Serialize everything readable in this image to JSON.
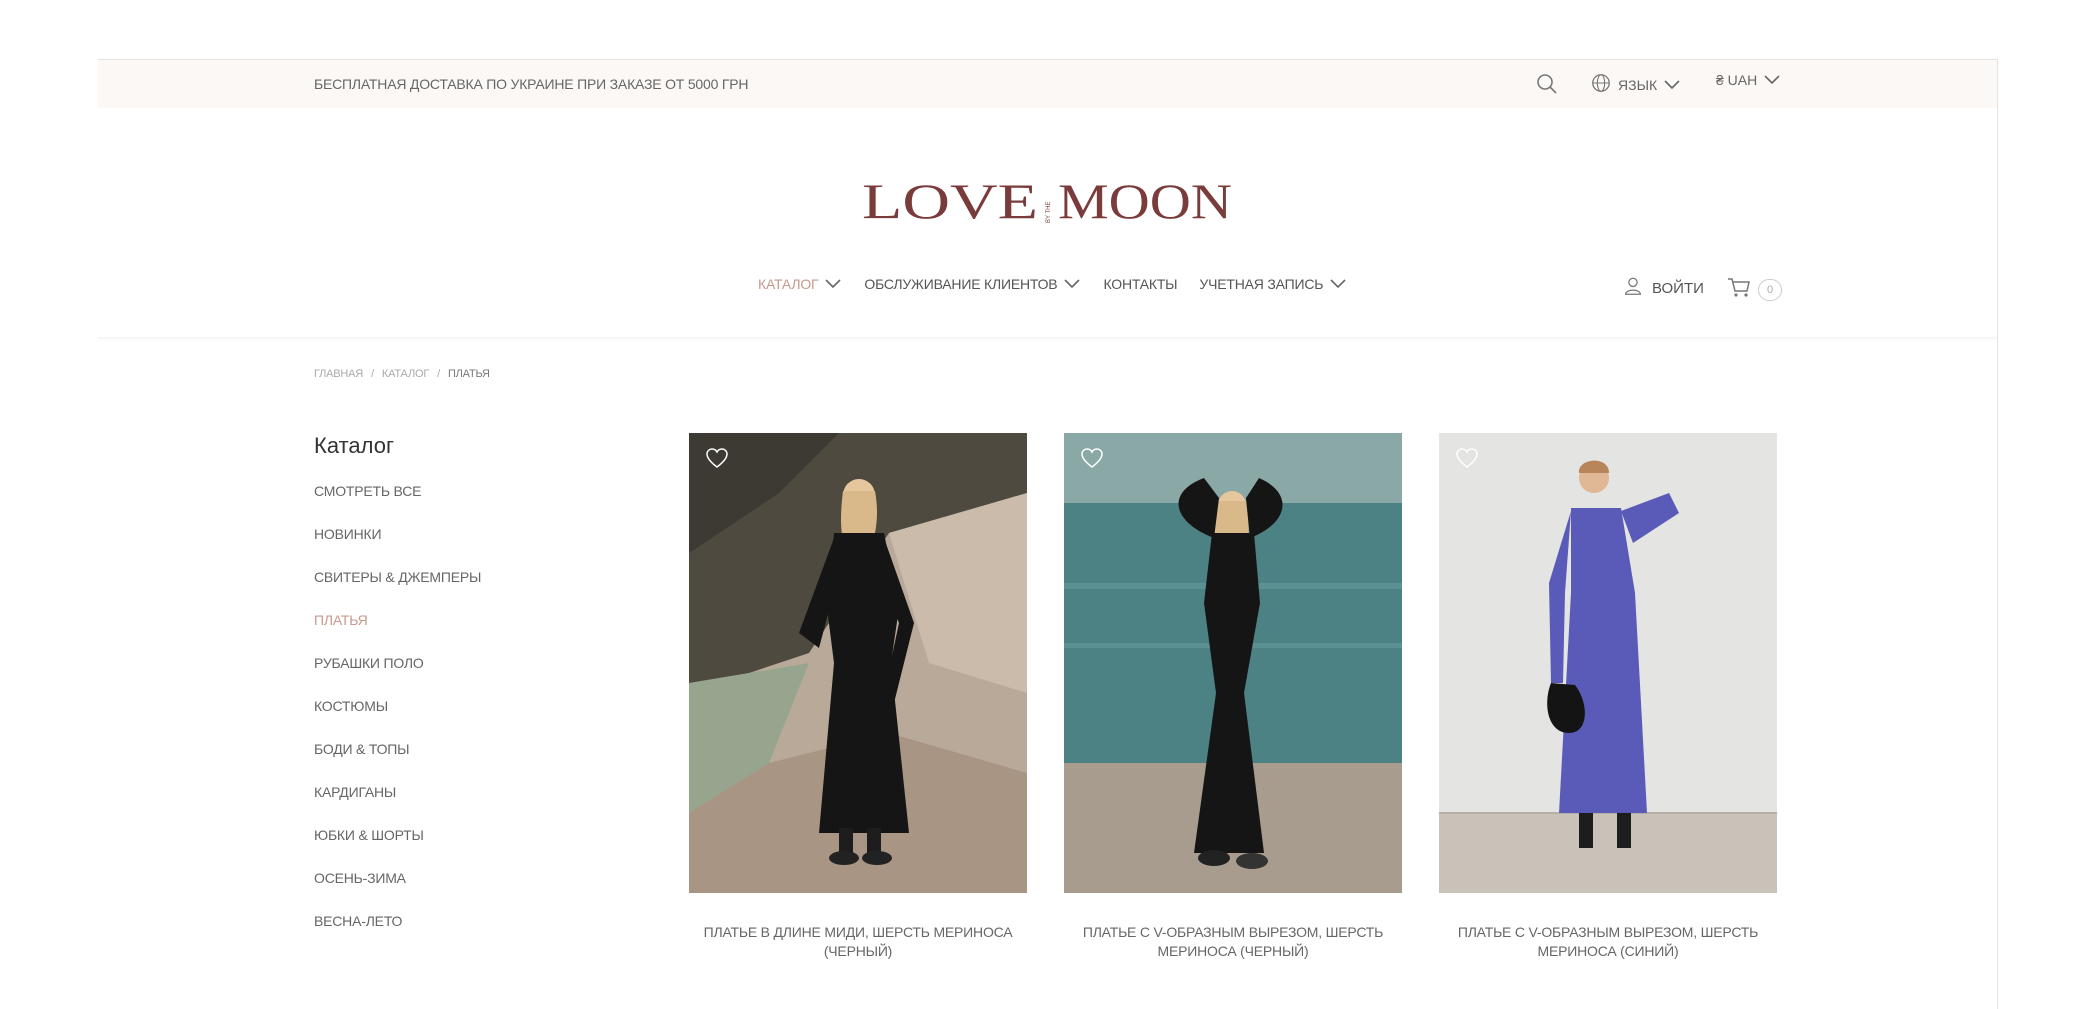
{
  "topbar": {
    "promo": "БЕСПЛАТНАЯ ДОСТАВКА ПО УКРАИНЕ ПРИ ЗАКАЗЕ ОТ 5000 ГРН",
    "language_label": "ЯЗЫК",
    "currency_label": "₴ UAH"
  },
  "logo": {
    "left": "LOVE",
    "middle": "BY THE",
    "right": "MOON",
    "color": "#7a3b3b"
  },
  "nav": {
    "items": [
      {
        "label": "КАТАЛОГ",
        "has_dropdown": true,
        "active": true
      },
      {
        "label": "ОБСЛУЖИВАНИЕ КЛИЕНТОВ",
        "has_dropdown": true,
        "active": false
      },
      {
        "label": "КОНТАКТЫ",
        "has_dropdown": false,
        "active": false
      },
      {
        "label": "УЧЕТНАЯ ЗАПИСЬ",
        "has_dropdown": true,
        "active": false
      }
    ],
    "login_label": "ВОЙТИ",
    "cart_count": "0"
  },
  "breadcrumb": {
    "home": "ГЛАВНАЯ",
    "catalog": "КАТАЛОГ",
    "current": "ПЛАТЬЯ",
    "separator": "/"
  },
  "sidebar": {
    "title": "Каталог",
    "items": [
      {
        "label": "СМОТРЕТЬ ВСЕ"
      },
      {
        "label": "НОВИНКИ"
      },
      {
        "label": "СВИТЕРЫ & ДЖЕМПЕРЫ"
      },
      {
        "label": "ПЛАТЬЯ",
        "active": true
      },
      {
        "label": "РУБАШКИ ПОЛО"
      },
      {
        "label": "КОСТЮМЫ"
      },
      {
        "label": "БОДИ & ТОПЫ"
      },
      {
        "label": "КАРДИГАНЫ"
      },
      {
        "label": "ЮБКИ & ШОРТЫ"
      },
      {
        "label": "ОСЕНЬ-ЗИМА"
      },
      {
        "label": "ВЕСНА-ЛЕТО"
      }
    ]
  },
  "products": [
    {
      "title": "ПЛАТЬЕ В ДЛИНЕ МИДИ, ШЕРСТЬ МЕРИНОСА (ЧЕРНЫЙ)",
      "dress_color": "#151515",
      "scene": "rocks-lake"
    },
    {
      "title": "ПЛАТЬЕ С V-ОБРАЗНЫМ ВЫРЕЗОМ, ШЕРСТЬ МЕРИНОСА (ЧЕРНЫЙ)",
      "dress_color": "#151515",
      "scene": "lake-shore"
    },
    {
      "title": "ПЛАТЬЕ С V-ОБРАЗНЫМ ВЫРЕЗОМ, ШЕРСТЬ МЕРИНОСА (СИНИЙ)",
      "dress_color": "#5a5ab8",
      "scene": "studio-wall"
    }
  ],
  "colors": {
    "accent": "#c79a8e",
    "topbar_bg": "#fcf8f5",
    "text": "#666666"
  }
}
